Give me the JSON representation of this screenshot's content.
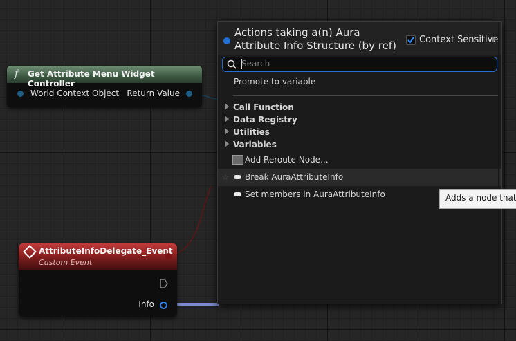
{
  "nodes": {
    "get_controller": {
      "icon": "function-icon",
      "title": "Get Attribute Menu Widget Controller",
      "input_pin": "World Context Object",
      "output_pin": "Return Value"
    },
    "event": {
      "icon": "event-diamond-icon",
      "title": "AttributeInfoDelegate_Event",
      "subtitle": "Custom Event",
      "output_pin": "Info"
    }
  },
  "menu": {
    "title": "Actions taking a(n) Aura Attribute Info Structure (by ref)",
    "context_sensitive_label": "Context Sensitive",
    "context_sensitive_checked": true,
    "search_placeholder": "Search",
    "search_value": "",
    "promote": "Promote to variable",
    "categories": [
      "Call Function",
      "Data Registry",
      "Utilities",
      "Variables"
    ],
    "reroute": "Add Reroute Node...",
    "items": [
      "Break AuraAttributeInfo",
      "Set members in AuraAttributeInfo"
    ]
  },
  "tooltip": "Adds a node that b",
  "colors": {
    "function_header": "#3e5a44",
    "event_header": "#8a1f1f",
    "accent": "#2c6bd1",
    "struct_pin": "#1f6fd6",
    "wire": "#7e8ad0"
  }
}
